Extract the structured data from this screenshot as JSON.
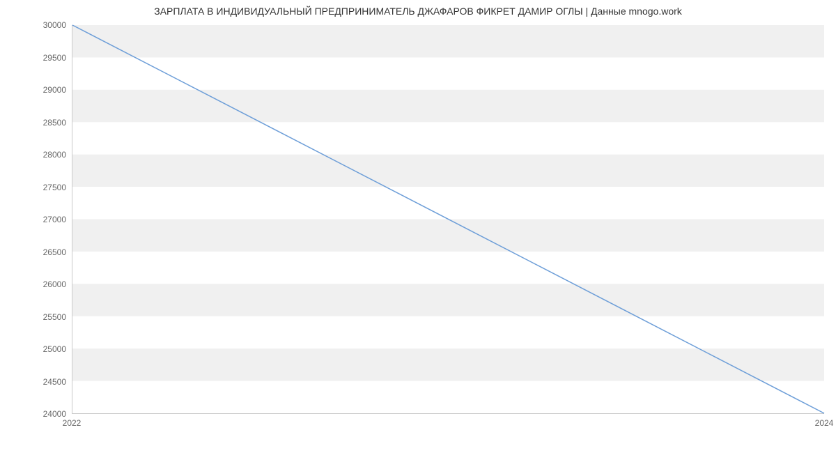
{
  "chart_data": {
    "type": "line",
    "title": "ЗАРПЛАТА В ИНДИВИДУАЛЬНЫЙ ПРЕДПРИНИМАТЕЛЬ ДЖАФАРОВ ФИКРЕТ ДАМИР ОГЛЫ | Данные mnogo.work",
    "xlabel": "",
    "ylabel": "",
    "x": [
      2022,
      2024
    ],
    "values": [
      30000,
      24000
    ],
    "y_ticks": [
      24000,
      24500,
      25000,
      25500,
      26000,
      26500,
      27000,
      27500,
      28000,
      28500,
      29000,
      29500,
      30000
    ],
    "x_ticks": [
      2022,
      2024
    ],
    "xlim": [
      2022,
      2024
    ],
    "ylim": [
      24000,
      30000
    ],
    "line_color": "#6d9ed8",
    "band_color": "#f0f0f0"
  }
}
